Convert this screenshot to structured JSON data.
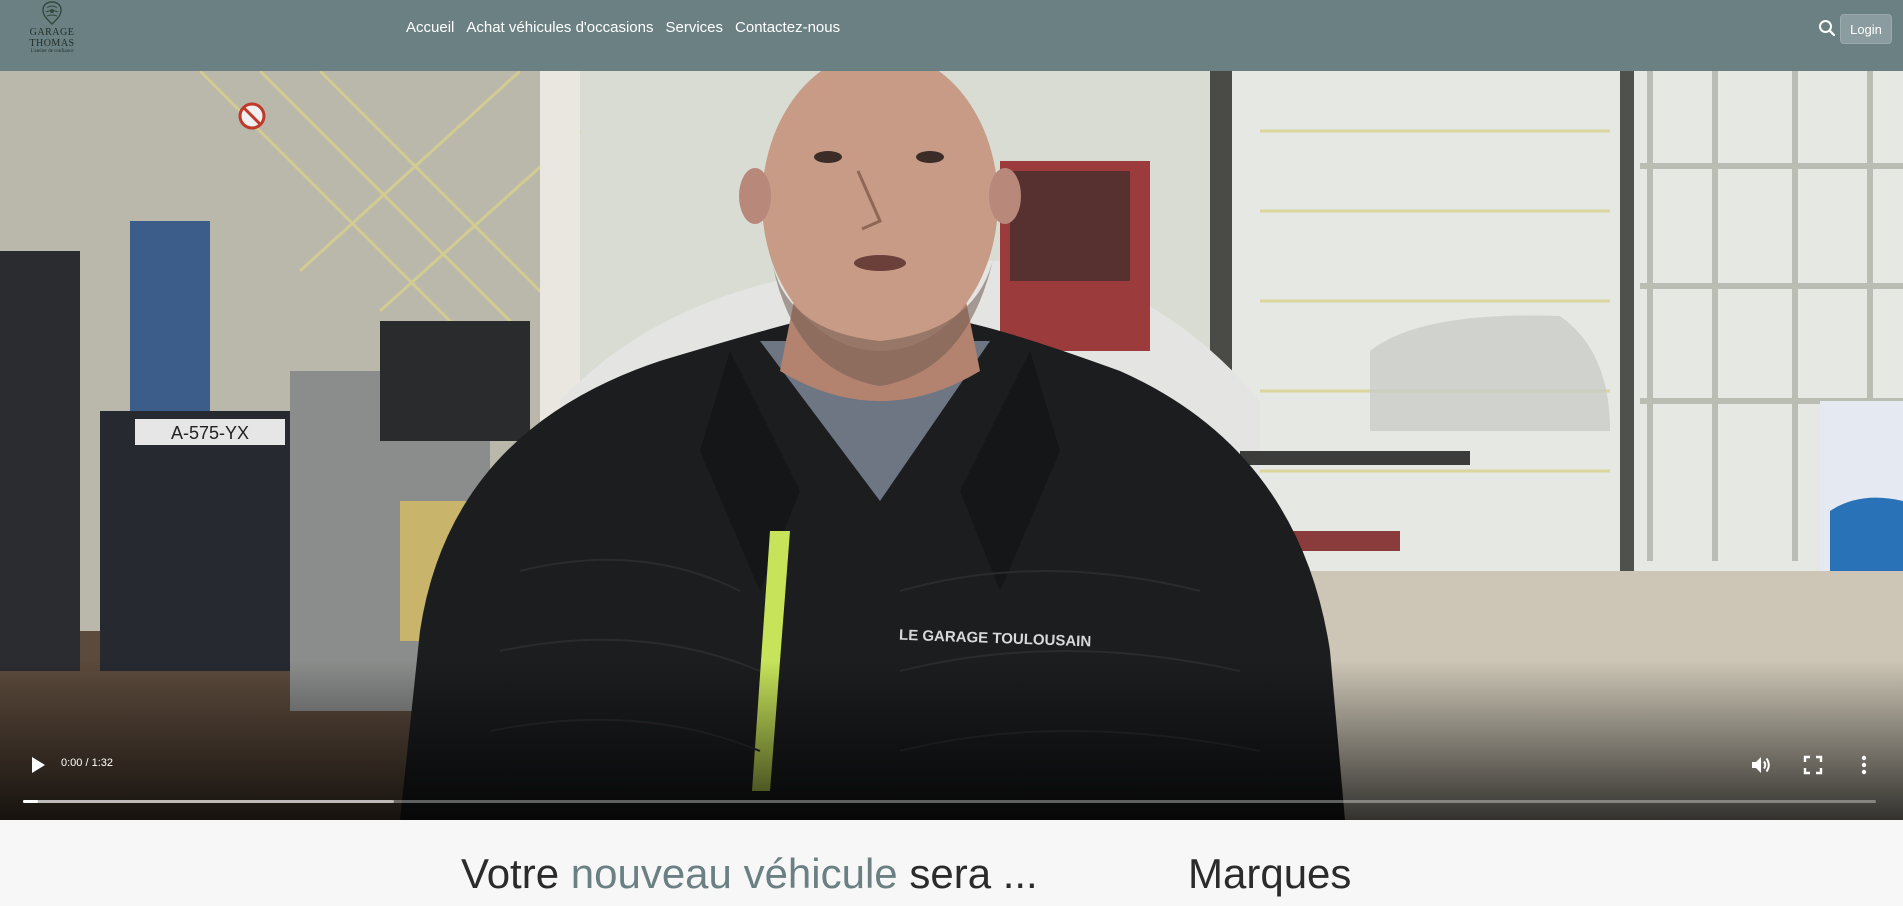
{
  "header": {
    "logo": {
      "title": "GARAGE THOMAS",
      "subtitle": "L'atelier de confiance",
      "icon": "crest-emblem"
    },
    "nav": [
      {
        "label": "Accueil"
      },
      {
        "label": "Achat véhicules d'occasions"
      },
      {
        "label": "Services"
      },
      {
        "label": "Contactez-nous"
      }
    ],
    "search_icon": "search-icon",
    "login_label": "Login",
    "background_color": "#6b8083"
  },
  "video": {
    "jacket_text": "LE GARAGE TOULOUSAIN",
    "plate_text": "A-575-YX",
    "time_display": "0:00 / 1:32",
    "progress_played": 0.008,
    "progress_buffered": 0.2,
    "controls": {
      "play_icon": "play-icon",
      "volume_icon": "volume-icon",
      "fullscreen_icon": "fullscreen-icon",
      "more_icon": "more-vertical-icon"
    }
  },
  "main": {
    "headline_prefix": "Votre",
    "headline_accent": "nouveau véhicule",
    "headline_suffix": "sera ...",
    "brands_title": "Marques",
    "accent_color": "#6b8083"
  }
}
